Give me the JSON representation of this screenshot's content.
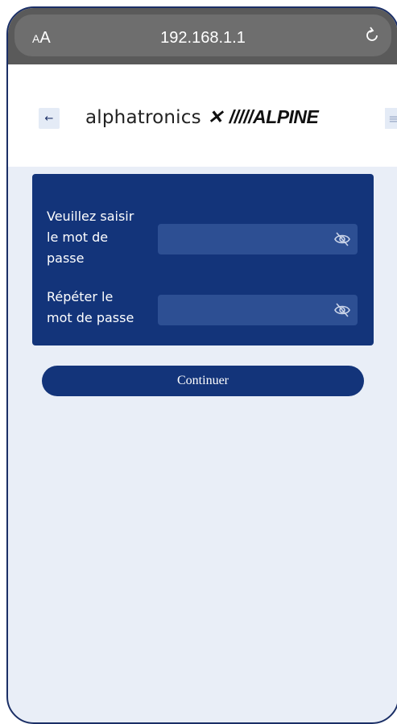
{
  "browser": {
    "text_size_small": "A",
    "text_size_large": "A",
    "url": "192.168.1.1"
  },
  "header": {
    "back_label": "←",
    "brand_left": "alphatronics",
    "brand_x": "✕",
    "brand_right": "/////ALPINE",
    "menu_label": "≡"
  },
  "form": {
    "password_label": "Veuillez saisir le mot de passe",
    "password_label_lines": [
      "Veuillez saisir",
      "le mot de",
      "passe"
    ],
    "repeat_label_lines": [
      "Répéter le",
      "mot de passe"
    ],
    "password_value": "",
    "repeat_value": "",
    "continue_label": "Continuer"
  },
  "colors": {
    "primary": "#13347a",
    "input_bg": "#2d4f93",
    "page_bg": "#e9eef7"
  }
}
